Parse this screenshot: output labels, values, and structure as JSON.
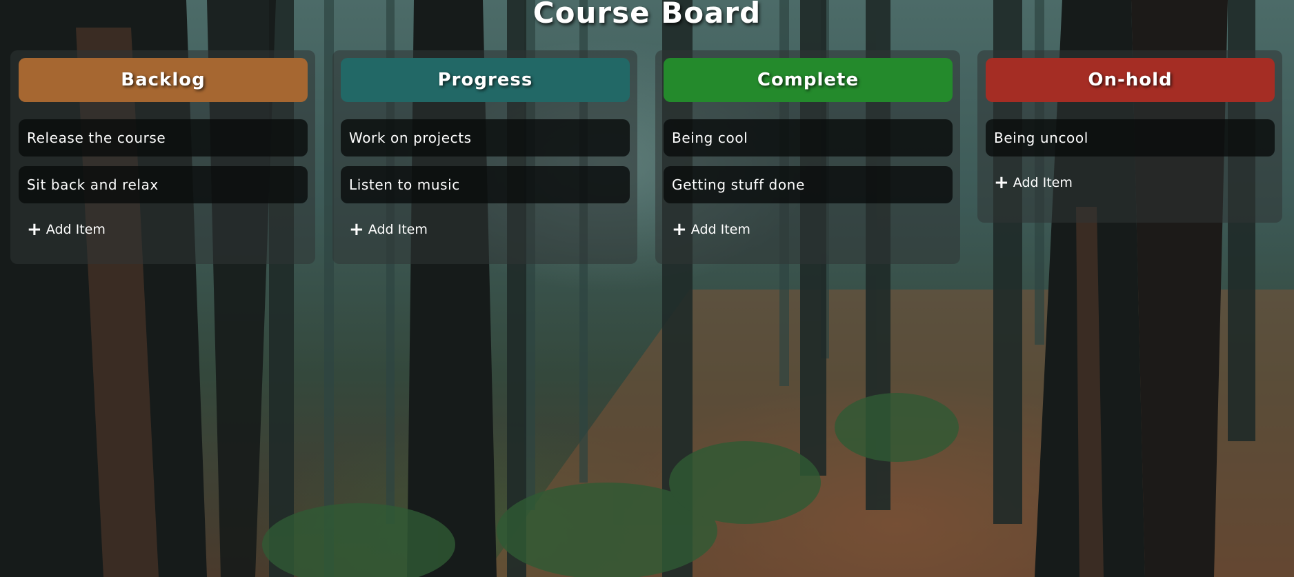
{
  "title": "Course Board",
  "columns": [
    {
      "name": "Backlog",
      "color": "#a66731",
      "items": [
        "Release the course",
        "Sit back and relax"
      ],
      "add_label": "Add Item"
    },
    {
      "name": "Progress",
      "color": "#226866",
      "items": [
        "Work on projects",
        "Listen to music"
      ],
      "add_label": "Add Item"
    },
    {
      "name": "Complete",
      "color": "#248a2c",
      "items": [
        "Being cool",
        "Getting stuff done"
      ],
      "add_label": "Add Item"
    },
    {
      "name": "On-hold",
      "color": "#a52d24",
      "items": [
        "Being uncool"
      ],
      "add_label": "Add Item"
    }
  ],
  "icons": {
    "add": "plus-icon"
  }
}
